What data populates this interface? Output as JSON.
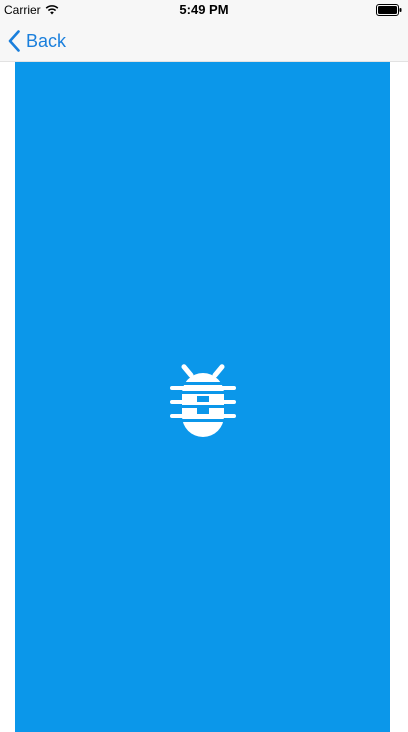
{
  "status_bar": {
    "carrier": "Carrier",
    "time": "5:49 PM",
    "wifi_icon": "wifi-icon",
    "battery_icon": "battery-icon"
  },
  "nav": {
    "back_label": "Back",
    "back_icon": "chevron-left-icon"
  },
  "content": {
    "background_color": "#0b97ea",
    "icon": "bug-icon",
    "icon_color": "#ffffff"
  },
  "colors": {
    "accent": "#1a7fdc"
  }
}
